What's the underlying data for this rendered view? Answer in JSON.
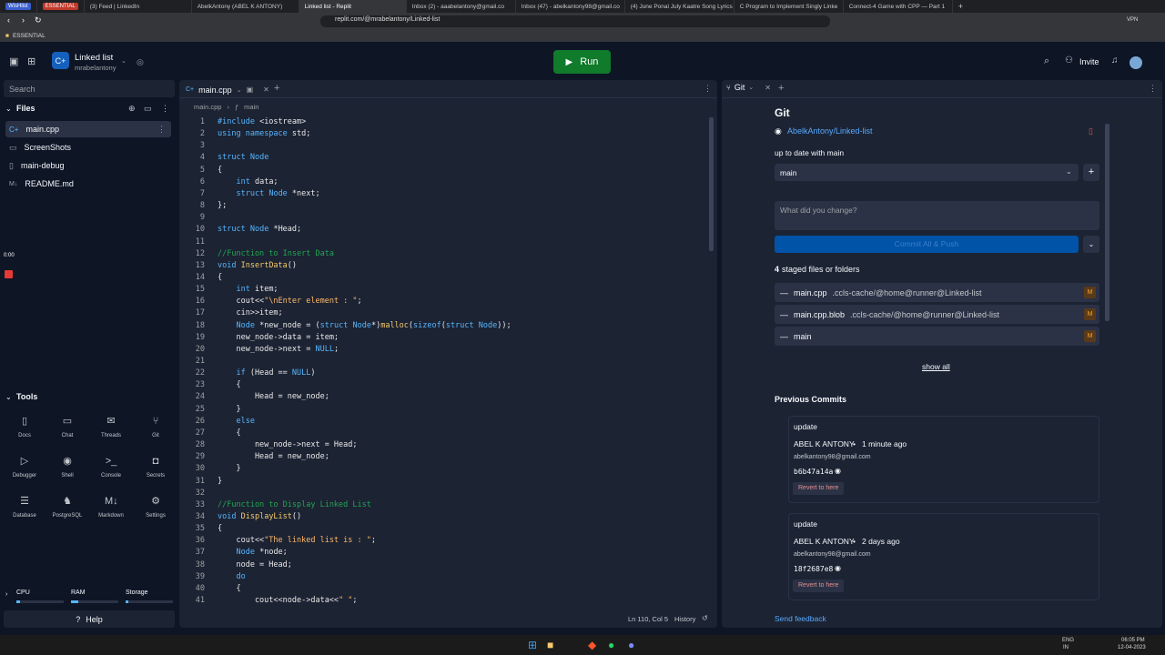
{
  "browser": {
    "tabs": [
      {
        "label": "WisHlist"
      },
      {
        "label": "ESSENTIAL"
      },
      {
        "label": "(3) Feed | LinkedIn"
      },
      {
        "label": "AbelkAntony (ABEL K ANTONY)"
      },
      {
        "label": "Linked list - Replit"
      },
      {
        "label": "Inbox (2) - aaabelantony@gmail.co"
      },
      {
        "label": "Inbox (47) - abelkantony98@gmail.co"
      },
      {
        "label": "(4) June Ponal July Kaatre Song Lyrics"
      },
      {
        "label": "C Program to Implement Singly Linke"
      },
      {
        "label": "Connect-4 Game with CPP — Part 1"
      }
    ],
    "url": "replit.com/@mrabelantony/Linked-list",
    "bookmark": "ESSENTIAL",
    "vpn": "VPN"
  },
  "header": {
    "repl_name": "Linked list",
    "owner": "mrabelantony",
    "run_label": "Run",
    "invite_label": "Invite"
  },
  "sidebar": {
    "search_placeholder": "Search",
    "files_title": "Files",
    "files": [
      {
        "name": "main.cpp"
      },
      {
        "name": "ScreenShots"
      },
      {
        "name": "main-debug"
      },
      {
        "name": "README.md"
      }
    ],
    "timer": "0:00",
    "tools_title": "Tools",
    "tools": [
      {
        "label": "Docs"
      },
      {
        "label": "Chat"
      },
      {
        "label": "Threads"
      },
      {
        "label": "Git"
      },
      {
        "label": "Debugger"
      },
      {
        "label": "Shell"
      },
      {
        "label": "Console"
      },
      {
        "label": "Secrets"
      },
      {
        "label": "Database"
      },
      {
        "label": "PostgreSQL"
      },
      {
        "label": "Markdown"
      },
      {
        "label": "Settings"
      }
    ],
    "resources": {
      "cpu": "CPU",
      "ram": "RAM",
      "storage": "Storage"
    },
    "help_label": "Help"
  },
  "editor": {
    "tab": "main.cpp",
    "breadcrumb_file": "main.cpp",
    "breadcrumb_symbol": "main",
    "status_pos": "Ln 110, Col 5",
    "history_label": "History",
    "lines": [
      "#include <iostream>",
      "using namespace std;",
      "",
      "struct Node",
      "{",
      "    int data;",
      "    struct Node *next;",
      "};",
      "",
      "struct Node *Head;",
      "",
      "//Function to Insert Data",
      "void InsertData()",
      "{",
      "    int item;",
      "    cout<<\"\\nEnter element : \";",
      "    cin>>item;",
      "    Node *new_node = (struct Node*)malloc(sizeof(struct Node));",
      "    new_node->data = item;",
      "    new_node->next = NULL;",
      "",
      "    if (Head == NULL)",
      "    {",
      "        Head = new_node;",
      "    }",
      "    else",
      "    {",
      "        new_node->next = Head;",
      "        Head = new_node;",
      "    }",
      "}",
      "",
      "//Function to Display Linked List",
      "void DisplayList()",
      "{",
      "    cout<<\"The linked list is : \";",
      "    Node *node;",
      "    node = Head;",
      "    do",
      "    {",
      "        cout<<node->data<<\" \";"
    ]
  },
  "git": {
    "tab": "Git",
    "title": "Git",
    "repo": "AbelkAntony/Linked-list",
    "status": "up to date with main",
    "branch": "main",
    "commit_placeholder": "What did you change?",
    "commit_button": "Commit All & Push",
    "staged_count": "4",
    "staged_label": "staged files or folders",
    "staged": [
      {
        "name": "main.cpp",
        "path": ".ccls-cache/@home@runner@Linked-list",
        "badge": "M"
      },
      {
        "name": "main.cpp.blob",
        "path": ".ccls-cache/@home@runner@Linked-list",
        "badge": "M"
      },
      {
        "name": "main",
        "path": "",
        "badge": "M"
      }
    ],
    "show_all": "show all",
    "previous_commits_title": "Previous Commits",
    "commits": [
      {
        "message": "update",
        "author": "ABEL K ANTONY",
        "time": "1 minute ago",
        "email": "abelkantony98@gmail.com",
        "hash": "b6b47a14a",
        "revert": "Revert to here"
      },
      {
        "message": "update",
        "author": "ABEL K ANTONY",
        "time": "2 days ago",
        "email": "abelkantony98@gmail.com",
        "hash": "18f2687e8",
        "revert": "Revert to here"
      }
    ],
    "send_feedback": "Send feedback"
  },
  "taskbar": {
    "lang": "ENG",
    "region": "IN",
    "time": "06:05 PM",
    "date": "12-04-2023"
  }
}
